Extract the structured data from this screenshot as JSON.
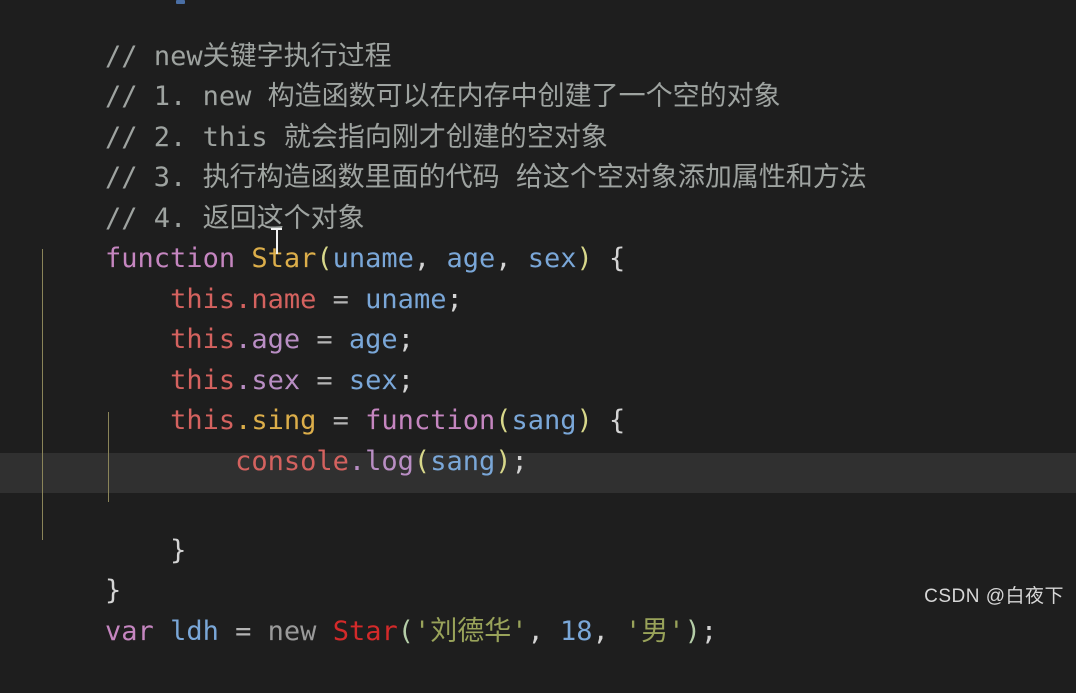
{
  "editor": {
    "theme": "dark",
    "background_color": "#1e1e1e",
    "highlight_row_color": "#303030",
    "indent_guide_color": "#8a8459",
    "language": "javascript",
    "font_size_px": 27,
    "line_height_px": 40.5
  },
  "lines": {
    "l1": {
      "c1": "// ",
      "c2": "new关键字执行过程"
    },
    "l2": {
      "c1": "// 1. new 构造函数可以在内存中创建了一个空的对象"
    },
    "l3": {
      "c1": "// 2. this 就会指向刚才创建的空对象"
    },
    "l4": {
      "c1": "// 3. 执行构造函数里面的代码 给这个空对象添加属性和方法"
    },
    "l5": {
      "c1": "// 4. 返回这个对象"
    },
    "l6": {
      "kw": "function",
      "sp1": " ",
      "name": "Star",
      "lparen": "(",
      "p1": "uname",
      "comma1": ", ",
      "p2": "age",
      "comma2": ", ",
      "p3": "sex",
      "rparen": ")",
      "sp2": " ",
      "brace": "{"
    },
    "l7": {
      "indent": "    ",
      "this": "this",
      "dot": ".",
      "prop": "name",
      "eq": " = ",
      "val": "uname",
      "semi": ";"
    },
    "l8": {
      "indent": "    ",
      "this": "this",
      "dot": ".",
      "prop": "age",
      "eq": " = ",
      "val": "age",
      "semi": ";"
    },
    "l9": {
      "indent": "    ",
      "this": "this",
      "dot": ".",
      "prop": "sex",
      "eq": " = ",
      "val": "sex",
      "semi": ";"
    },
    "l10": {
      "indent": "    ",
      "this": "this",
      "dot": ".",
      "prop": "sing",
      "eq": " = ",
      "kw": "function",
      "lparen": "(",
      "p1": "sang",
      "rparen": ")",
      "sp": " ",
      "brace": "{"
    },
    "l11": {
      "indent": "        ",
      "obj": "console",
      "dot": ".",
      "method": "log",
      "lparen": "(",
      "arg": "sang",
      "rparen": ")",
      "semi": ";"
    },
    "l12": {
      "text": ""
    },
    "l13": {
      "indent": "    ",
      "brace": "}"
    },
    "l14": {
      "brace": "}"
    },
    "l15": {
      "kw": "var",
      "sp1": " ",
      "varname": "ldh",
      "eq": " = ",
      "new": "new",
      "sp2": " ",
      "ctor": "Star",
      "lparen": "(",
      "s1": "'刘德华'",
      "comma1": ", ",
      "num": "18",
      "comma2": ", ",
      "s2": "'男'",
      "rparen": ")",
      "semi": ";"
    }
  },
  "watermark": {
    "text": "CSDN @白夜下"
  }
}
